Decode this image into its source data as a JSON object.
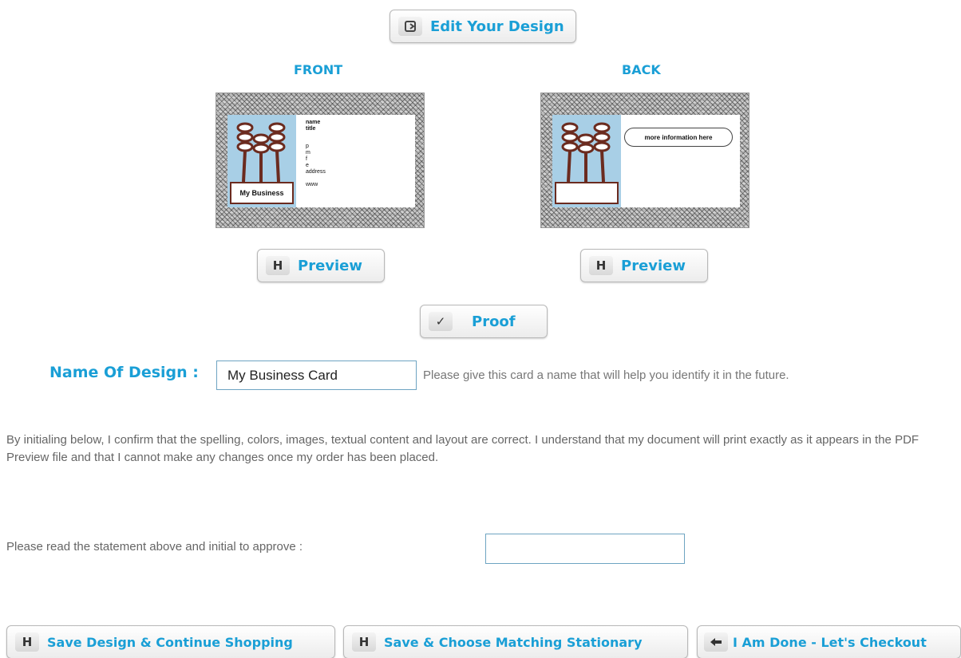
{
  "edit_button": {
    "label": "Edit Your Design",
    "icon": "edit-icon"
  },
  "front": {
    "heading": "FRONT",
    "preview_label": "Preview"
  },
  "back": {
    "heading": "BACK",
    "preview_label": "Preview"
  },
  "proof_button": {
    "label": "Proof",
    "icon": "checkmark-icon"
  },
  "front_card": {
    "business_name": "My Business",
    "lines": [
      "name",
      "title",
      "p",
      "m",
      "f",
      "e",
      "address",
      "www"
    ]
  },
  "back_card": {
    "info": "more information here"
  },
  "design_name": {
    "label": "Name Of Design :",
    "value": "My Business Card",
    "hint": "Please give this card a name that will help you identify it in the future."
  },
  "statement": "By initialing below, I confirm that the spelling, colors, images, textual content and layout are correct. I understand that my document will print exactly as it appears in the PDF Preview file and that I cannot make any changes once my order has been placed.",
  "initial": {
    "label": "Please read the statement above and initial to approve :",
    "value": ""
  },
  "actions": {
    "save_continue": "Save Design & Continue Shopping",
    "save_matching": "Save & Choose Matching Stationary",
    "checkout": "I Am Done - Let's Checkout"
  },
  "colors": {
    "accent": "#1a9fd6",
    "card_panel": "#a8cfe6",
    "card_border": "#6b2b1f"
  }
}
